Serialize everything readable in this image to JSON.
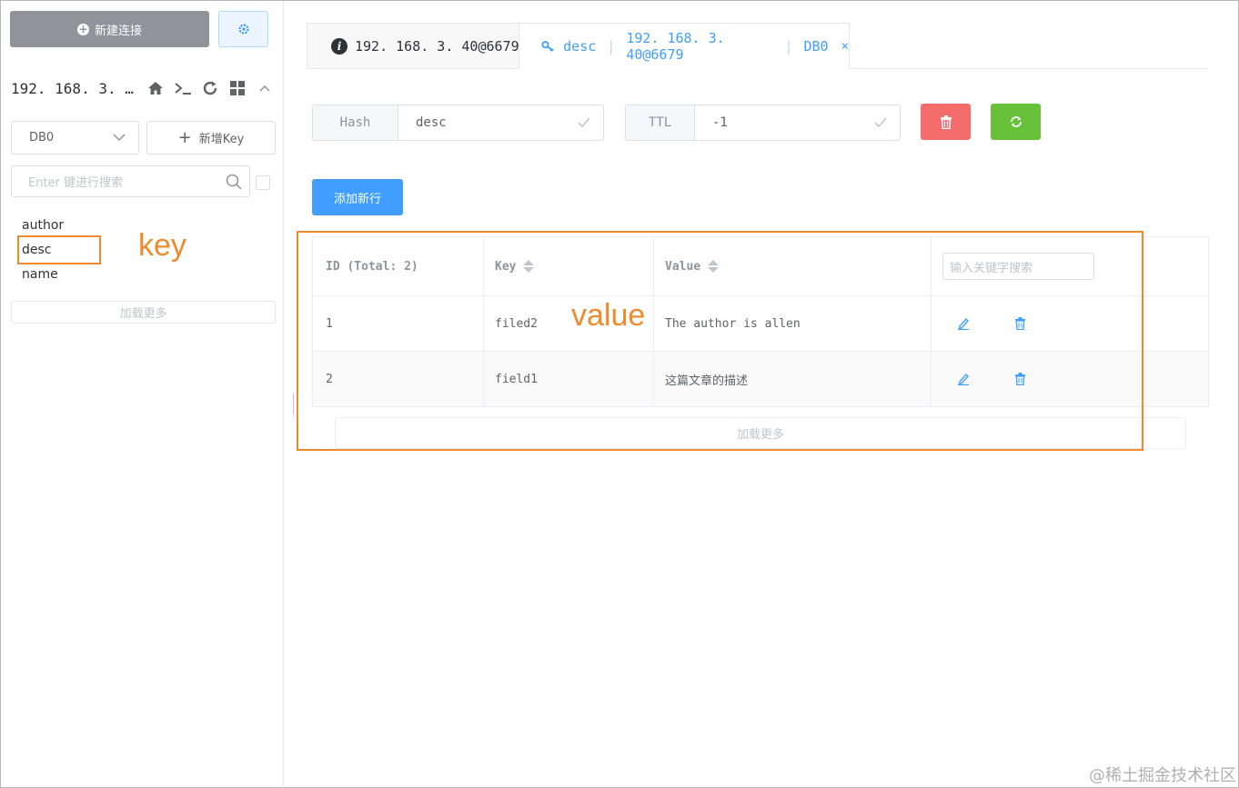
{
  "sidebar": {
    "new_connection_label": "新建连接",
    "connection_title": "192. 168. 3. …",
    "db_select_value": "DB0",
    "new_key_label": "新增Key",
    "search_placeholder": "Enter 键进行搜索",
    "keys": [
      "author",
      "desc",
      "name"
    ],
    "load_more_label": "加载更多"
  },
  "annotations": {
    "key": "key",
    "value": "value"
  },
  "tabs": {
    "info_label": "192. 168. 3. 40@6679",
    "key_tab": {
      "key": "desc",
      "conn": "192. 168. 3. 40@6679",
      "db": "DB0",
      "close": "×"
    }
  },
  "key_detail": {
    "type": "Hash",
    "key_name": "desc",
    "ttl_label": "TTL",
    "ttl_value": "-1",
    "add_row_label": "添加新行"
  },
  "table": {
    "columns": {
      "id": "ID (Total: 2)",
      "key": "Key",
      "value": "Value"
    },
    "search_placeholder": "输入关键字搜索",
    "rows": [
      {
        "id": "1",
        "key": "filed2",
        "value": "The author is allen"
      },
      {
        "id": "2",
        "key": "field1",
        "value": "这篇文章的描述"
      }
    ],
    "load_more_label": "加载更多"
  },
  "colors": {
    "primary": "#409eff",
    "danger": "#f56c6c",
    "success": "#67c23a",
    "annotation": "#f08a2e"
  },
  "watermark": "@稀土掘金技术社区"
}
